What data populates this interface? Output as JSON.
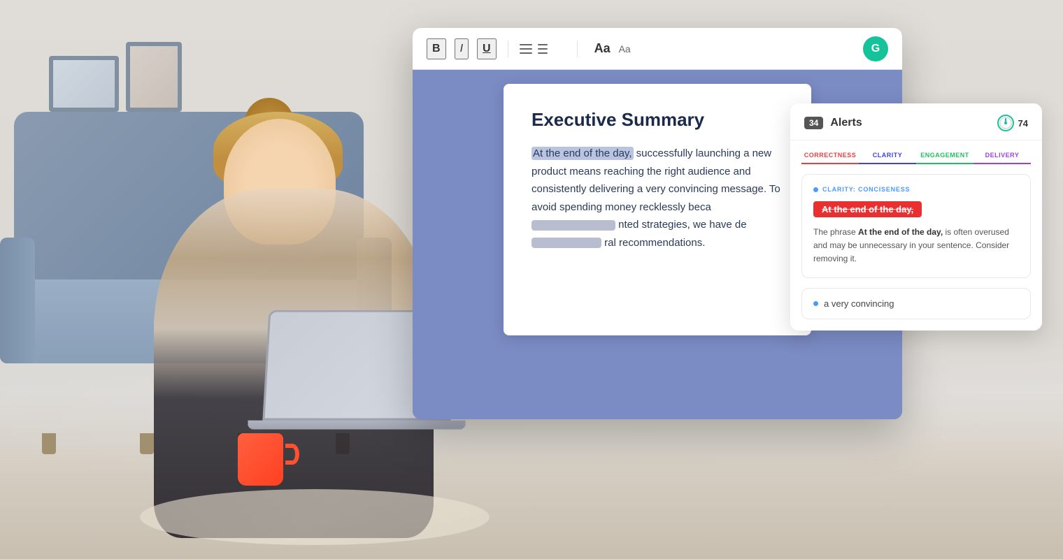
{
  "scene": {
    "background_color": "#e0e2e6"
  },
  "editor_window": {
    "toolbar": {
      "bold_label": "B",
      "italic_label": "I",
      "underline_label": "U",
      "font_label": "Aa",
      "font_small_label": "Aa"
    },
    "grammarly_icon": "G",
    "document": {
      "title": "Executive Summary",
      "paragraph": "At the end of the day, successfully launching a new product means reaching the right audience and consistently delivering a very convincing message. To avoid spending money recklessly beca",
      "highlight": "At the end of the day,",
      "obscured1": "nted strategies, we have",
      "obscured2": "ral recommendations.",
      "para_prefix": "",
      "para_mid": ", successfully launching a new product means reaching the right audience and consistently delivering a very convincing message. To avoid spending money recklessly beca",
      "para_end": "de"
    }
  },
  "alerts_panel": {
    "badge_count": "34",
    "title": "Alerts",
    "score": "74",
    "categories": [
      {
        "id": "correctness",
        "label": "CORRECTNESS",
        "active": false
      },
      {
        "id": "clarity",
        "label": "CLARITY",
        "active": true
      },
      {
        "id": "engagement",
        "label": "ENGAGEMENT",
        "active": false
      },
      {
        "id": "delivery",
        "label": "DELIVERY",
        "active": false
      }
    ],
    "suggestion1": {
      "label": "CLARITY: CONCISENESS",
      "highlighted_phrase": "At the end of the day,",
      "description_prefix": "The phrase ",
      "description_bold": "At the end of the day,",
      "description_suffix": " is often overused and may be unnecessary in your sentence. Consider removing it."
    },
    "suggestion2": {
      "text": "a very convincing"
    }
  }
}
